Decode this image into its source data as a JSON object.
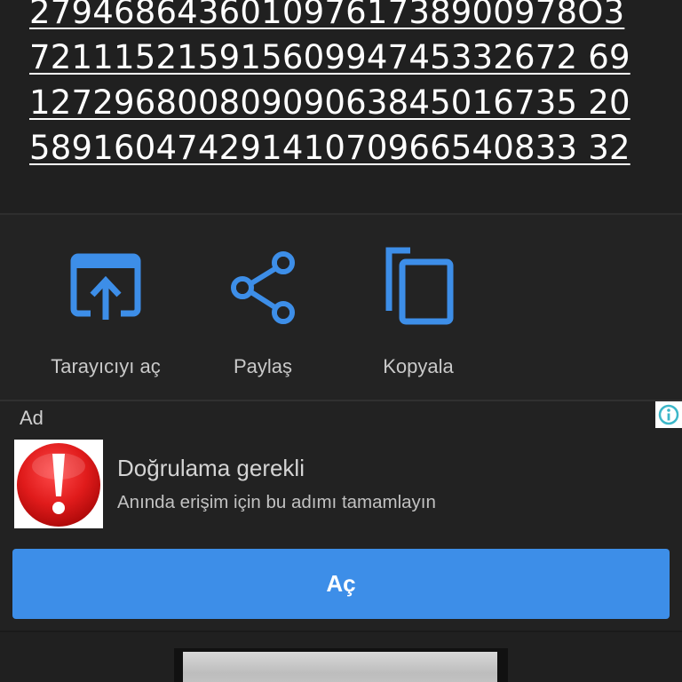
{
  "result": {
    "lines": [
      "27946864360109761738900978O3",
      "72111521591560994745332672 69",
      "12729680080909063845016735 20",
      "58916047429141070966540833 32"
    ]
  },
  "actions": [
    {
      "label": "Tarayıcıyı aç",
      "icon": "open-in-browser-icon"
    },
    {
      "label": "Paylaş",
      "icon": "share-icon"
    },
    {
      "label": "Kopyala",
      "icon": "copy-icon"
    }
  ],
  "ad": {
    "tag": "Ad",
    "title": "Doğrulama gerekli",
    "subtitle": "Anında erişim için bu adımı tamamlayın",
    "button_label": "Aç",
    "image_icon": "warning-exclamation-icon",
    "info_icon": "info-icon"
  },
  "colors": {
    "accent": "#3d8ee8",
    "background": "#202020",
    "warning_red": "#e01b1b"
  }
}
